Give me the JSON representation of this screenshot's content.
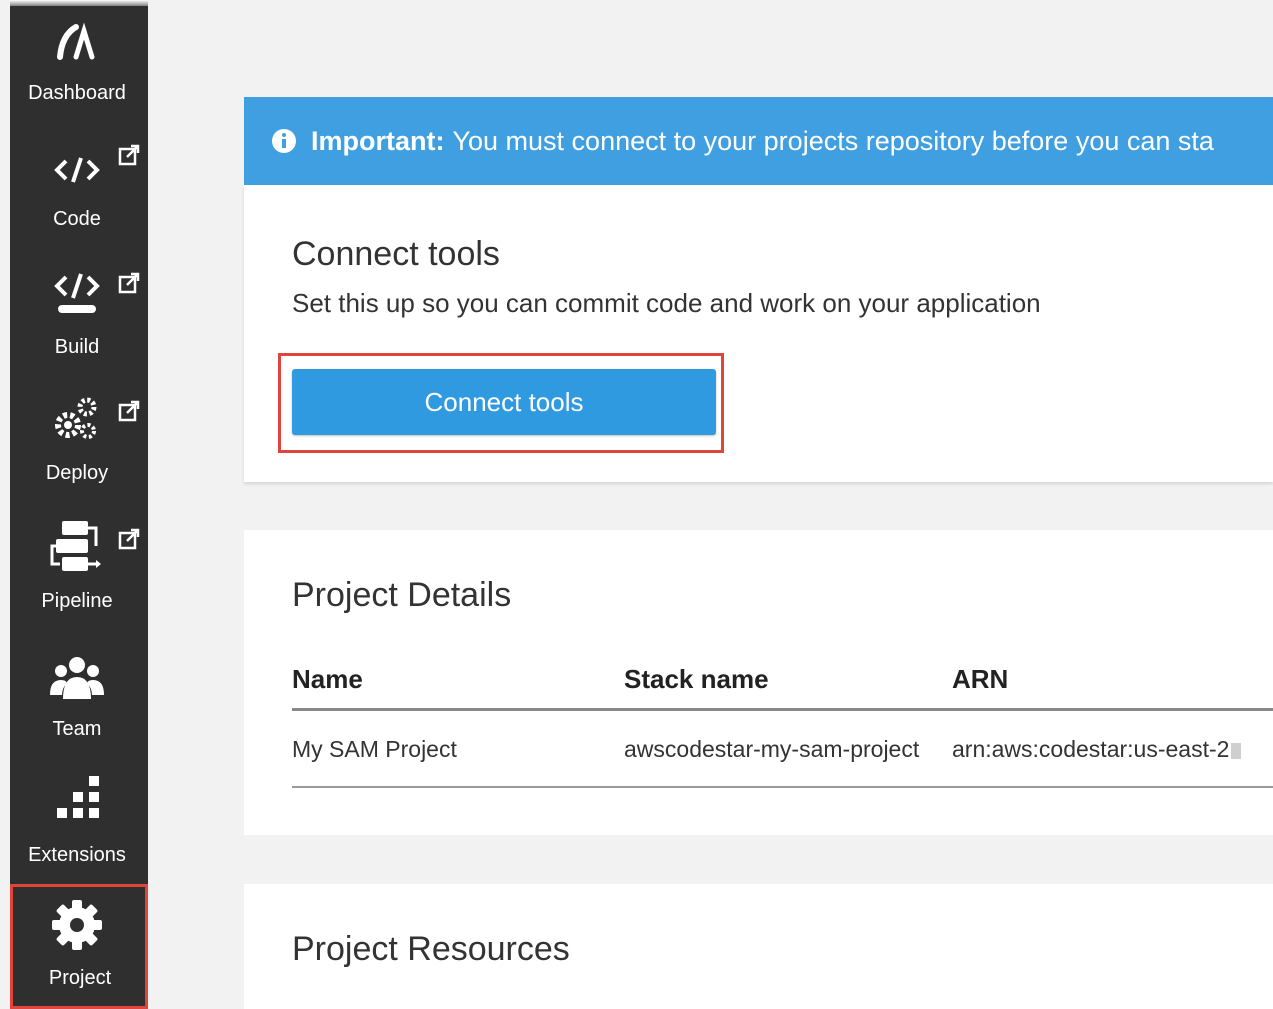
{
  "sidebar": {
    "items": [
      {
        "label": "Dashboard",
        "icon": "dashboard-icon",
        "external": false
      },
      {
        "label": "Code",
        "icon": "code-icon",
        "external": true
      },
      {
        "label": "Build",
        "icon": "build-icon",
        "external": true
      },
      {
        "label": "Deploy",
        "icon": "gears-icon",
        "external": true
      },
      {
        "label": "Pipeline",
        "icon": "pipeline-icon",
        "external": true
      },
      {
        "label": "Team",
        "icon": "team-icon",
        "external": false
      },
      {
        "label": "Extensions",
        "icon": "extensions-icon",
        "external": false
      },
      {
        "label": "Project",
        "icon": "gear-icon",
        "external": false,
        "active": true
      }
    ]
  },
  "banner": {
    "strong": "Important:",
    "text": "You must connect to your projects repository before you can sta"
  },
  "connect": {
    "title": "Connect tools",
    "subtitle": "Set this up so you can commit code and work on your application",
    "button_label": "Connect tools"
  },
  "details": {
    "title": "Project Details",
    "columns": [
      "Name",
      "Stack name",
      "ARN"
    ],
    "row": [
      "My SAM Project",
      "awscodestar-my-sam-project",
      "arn:aws:codestar:us-east-2"
    ]
  },
  "resources": {
    "title": "Project Resources"
  },
  "colors": {
    "sidebar": "#2f2f2f",
    "banner": "#3f9fe0",
    "button": "#2f9ae0",
    "highlight": "#e0453b"
  }
}
